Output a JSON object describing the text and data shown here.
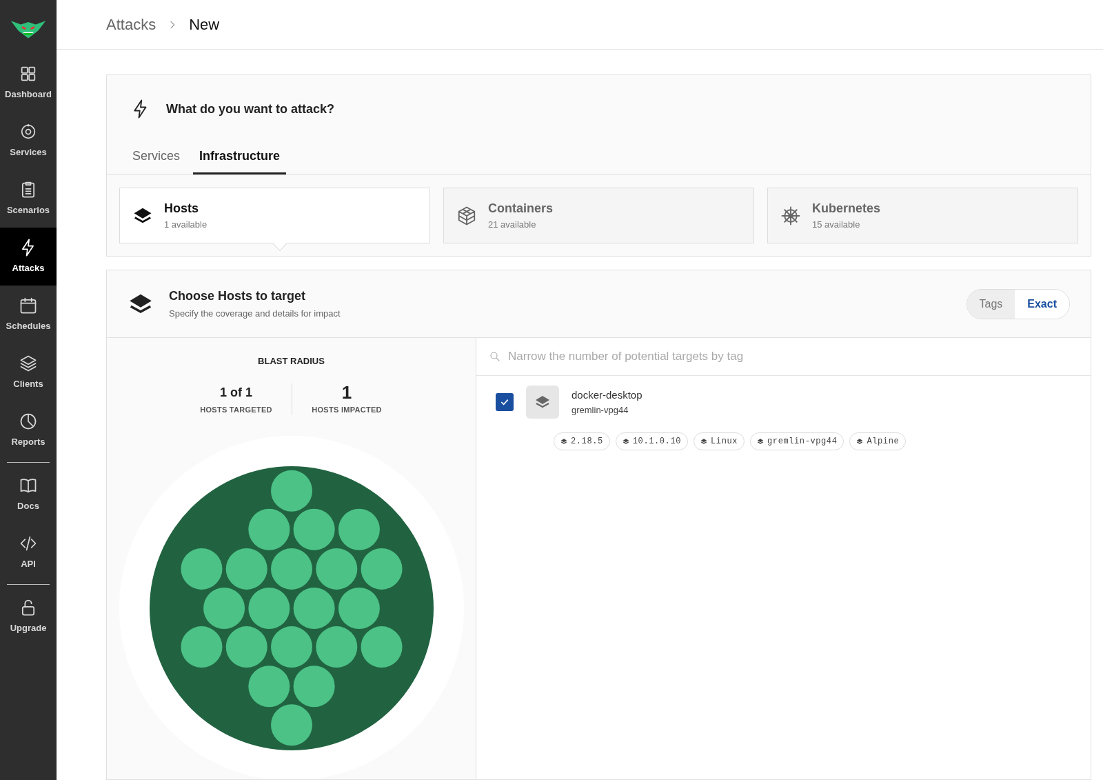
{
  "sidebar": {
    "items": [
      {
        "label": "Dashboard",
        "selected": false,
        "divider_before": false
      },
      {
        "label": "Services",
        "selected": false,
        "divider_before": false
      },
      {
        "label": "Scenarios",
        "selected": false,
        "divider_before": false
      },
      {
        "label": "Attacks",
        "selected": true,
        "divider_before": false
      },
      {
        "label": "Schedules",
        "selected": false,
        "divider_before": false
      },
      {
        "label": "Clients",
        "selected": false,
        "divider_before": false
      },
      {
        "label": "Reports",
        "selected": false,
        "divider_before": false
      },
      {
        "label": "Docs",
        "selected": false,
        "divider_before": true
      },
      {
        "label": "API",
        "selected": false,
        "divider_before": false
      },
      {
        "label": "Upgrade",
        "selected": false,
        "divider_before": true
      }
    ]
  },
  "breadcrumb": [
    "Attacks",
    "New"
  ],
  "attack_panel": {
    "title": "What do you want to attack?",
    "tabs": [
      {
        "label": "Services",
        "selected": false
      },
      {
        "label": "Infrastructure",
        "selected": true
      }
    ],
    "targets": [
      {
        "label": "Hosts",
        "count": "1 available",
        "selected": true
      },
      {
        "label": "Containers",
        "count": "21 available",
        "selected": false
      },
      {
        "label": "Kubernetes",
        "count": "15 available",
        "selected": false
      }
    ]
  },
  "hosts_panel": {
    "title": "Choose Hosts to target",
    "subtitle": "Specify the coverage and details for impact",
    "mode_toggle": [
      {
        "label": "Tags",
        "selected": false
      },
      {
        "label": "Exact",
        "selected": true
      }
    ],
    "blast_radius": {
      "title": "BLAST RADIUS",
      "stats": [
        {
          "value": "1 of 1",
          "label": "HOSTS TARGETED"
        },
        {
          "value": "1",
          "label": "HOSTS IMPACTED"
        }
      ]
    },
    "search": {
      "placeholder": "Narrow the number of potential targets by tag"
    },
    "hosts": [
      {
        "name": "docker-desktop",
        "id": "gremlin-vpg44",
        "checked": true,
        "tags": [
          "2.18.5",
          "10.1.0.10",
          "Linux",
          "gremlin-vpg44",
          "Alpine"
        ]
      }
    ]
  }
}
